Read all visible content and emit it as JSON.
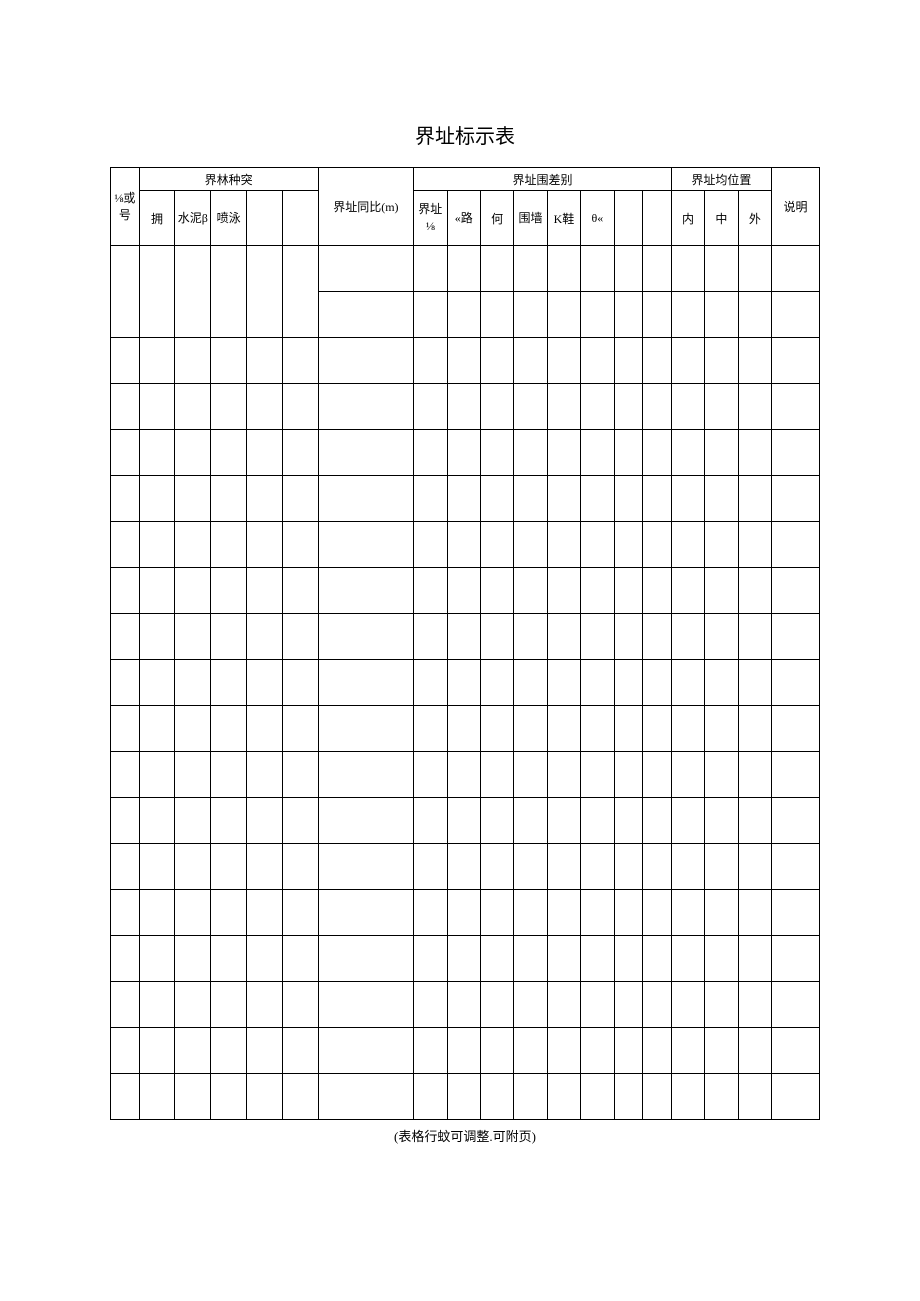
{
  "title": "界址标示表",
  "headers": {
    "group1": "界林种突",
    "group2": "界址围差别",
    "group3": "界址均位置",
    "col0": "⅛或号",
    "col1": "拥",
    "col2": "水泥β",
    "col3": "喷泳",
    "col4": "",
    "col5": "",
    "col6": "界址同比(m)",
    "col7": "界址⅛",
    "col8": "«路",
    "col9": "何",
    "col10": "围墙",
    "col11": "K鞋",
    "col12": "θ«",
    "col13": "",
    "col14": "",
    "col15": "内",
    "col16": "中",
    "col17": "外",
    "col18": "说明"
  },
  "footnote": "(表格行蚊可调整.可附页)",
  "rowCountA": 18,
  "rowCountB": 19
}
